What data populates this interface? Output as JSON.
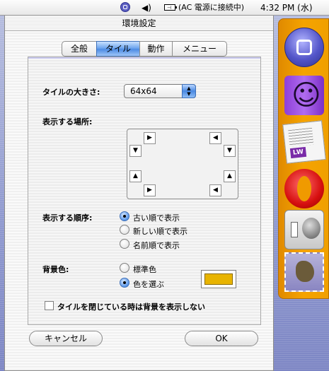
{
  "menubar": {
    "status_text": "(AC 電源に接続中)",
    "time": "4:32 PM (水)"
  },
  "window": {
    "title": "環境設定",
    "tabs": [
      {
        "label": "全般",
        "active": false
      },
      {
        "label": "タイル",
        "active": true
      },
      {
        "label": "動作",
        "active": false
      },
      {
        "label": "メニュー",
        "active": false
      }
    ]
  },
  "tile_size": {
    "label": "タイルの大きさ:",
    "value": "64x64"
  },
  "location": {
    "label": "表示する場所:"
  },
  "order": {
    "label": "表示する順序:",
    "options": [
      {
        "label": "古い順で表示",
        "selected": true
      },
      {
        "label": "新しい順で表示",
        "selected": false
      },
      {
        "label": "名前順で表示",
        "selected": false
      }
    ]
  },
  "background": {
    "label": "背景色:",
    "options": [
      {
        "label": "標準色",
        "selected": false
      },
      {
        "label": "色を選ぶ",
        "selected": true
      }
    ],
    "color": "#e8b400"
  },
  "hide_bg_checkbox": {
    "label": "タイルを閉じている時は背景を表示しない",
    "checked": false
  },
  "buttons": {
    "cancel": "キャンセル",
    "ok": "OK"
  },
  "dock": {
    "items": [
      "classic-icon",
      "finder-icon",
      "lightwaytext-icon",
      "opera-icon",
      "system-prefs-icon",
      "mail-icon"
    ],
    "lw_tag": "LW"
  }
}
